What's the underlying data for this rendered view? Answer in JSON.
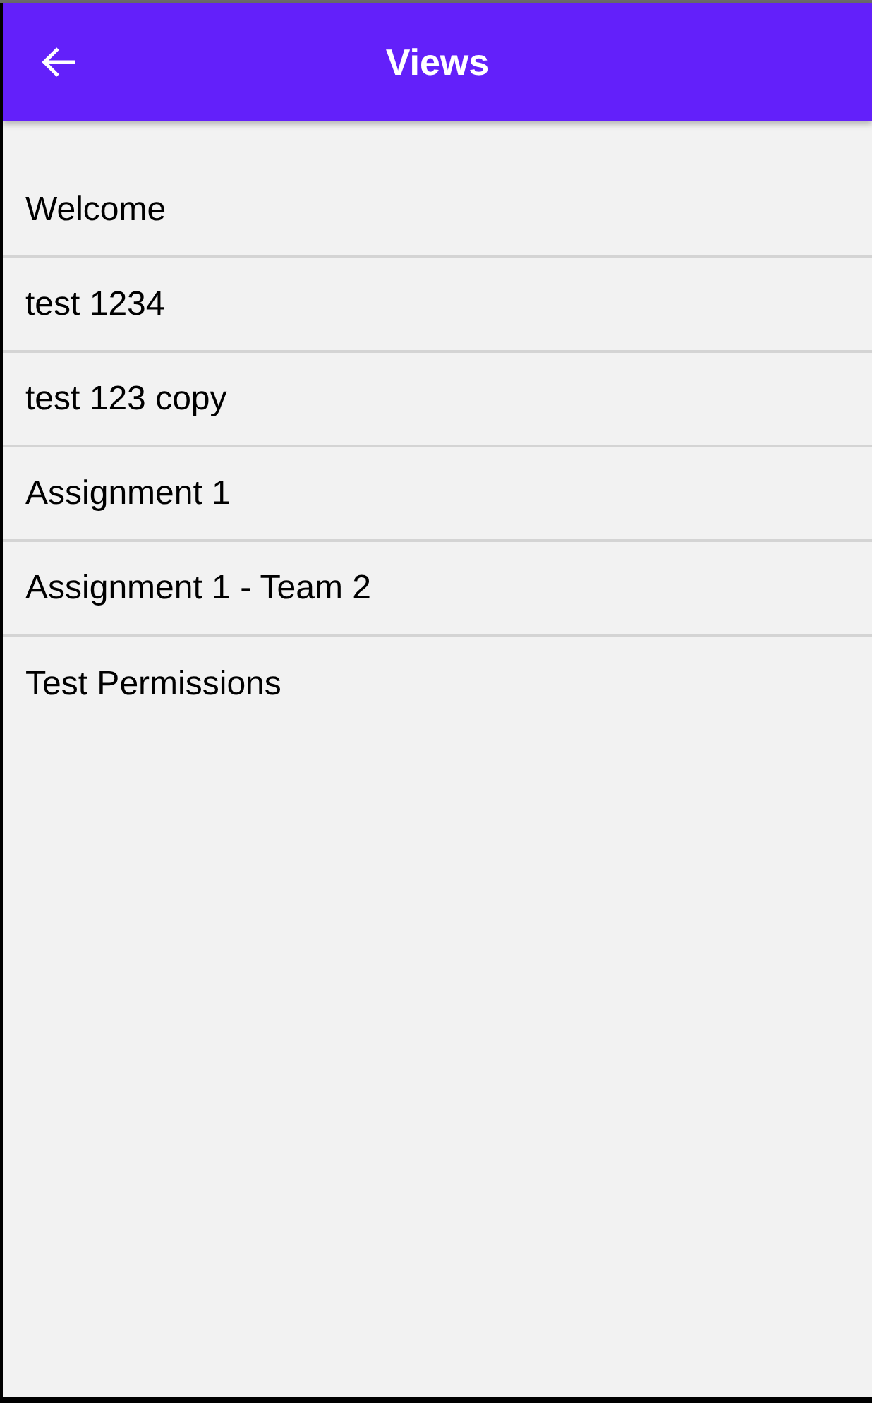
{
  "app_bar": {
    "title": "Views"
  },
  "views": [
    {
      "label": "Welcome"
    },
    {
      "label": "test 1234"
    },
    {
      "label": "test 123 copy"
    },
    {
      "label": "Assignment 1"
    },
    {
      "label": "Assignment 1 - Team 2"
    },
    {
      "label": "Test Permissions"
    }
  ]
}
